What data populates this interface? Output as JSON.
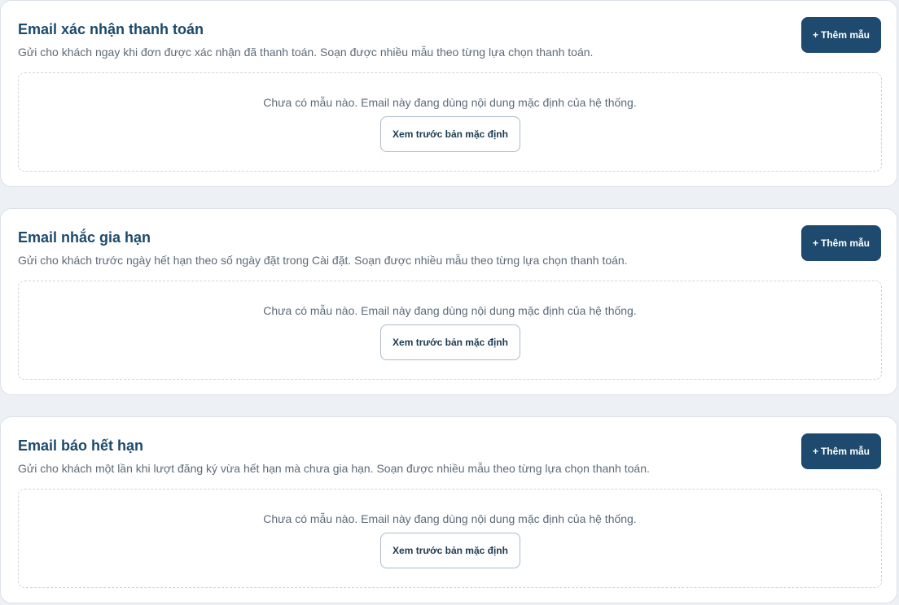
{
  "cards": [
    {
      "title": "Email xác nhận thanh toán",
      "description": "Gửi cho khách ngay khi đơn được xác nhận đã thanh toán. Soạn được nhiều mẫu theo từng lựa chọn thanh toán.",
      "add_label": "Thêm mẫu",
      "empty_text": "Chưa có mẫu nào. Email này đang dùng nội dung mặc định của hệ thống.",
      "preview_label": "Xem trước bản mặc định"
    },
    {
      "title": "Email nhắc gia hạn",
      "description": "Gửi cho khách trước ngày hết hạn theo số ngày đặt trong Cài đặt. Soạn được nhiều mẫu theo từng lựa chọn thanh toán.",
      "add_label": "Thêm mẫu",
      "empty_text": "Chưa có mẫu nào. Email này đang dùng nội dung mặc định của hệ thống.",
      "preview_label": "Xem trước bản mặc định"
    },
    {
      "title": "Email báo hết hạn",
      "description": "Gửi cho khách một lần khi lượt đăng ký vừa hết hạn mà chưa gia hạn. Soạn được nhiều mẫu theo từng lựa chọn thanh toán.",
      "add_label": "Thêm mẫu",
      "empty_text": "Chưa có mẫu nào. Email này đang dùng nội dung mặc định của hệ thống.",
      "preview_label": "Xem trước bản mặc định"
    }
  ],
  "icons": {
    "add": "plus-icon"
  },
  "colors": {
    "primary": "#1d4a6e",
    "title": "#1b4a6b",
    "muted_text": "#5d6b79",
    "page_bg": "#edf0f4"
  }
}
